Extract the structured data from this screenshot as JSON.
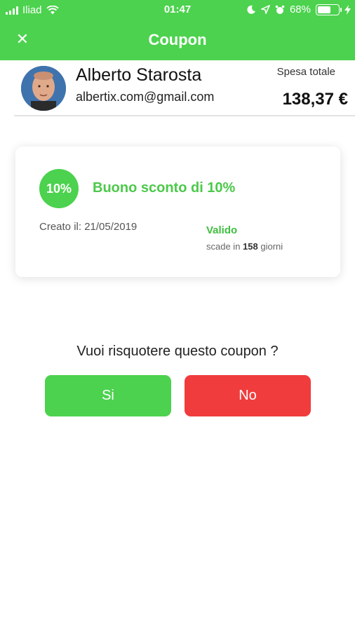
{
  "status_bar": {
    "carrier": "Iliad",
    "time": "01:47",
    "battery_text": "68%",
    "battery_level": 0.68
  },
  "header": {
    "title": "Coupon",
    "close_icon": "close-icon"
  },
  "user": {
    "name": "Alberto Starosta",
    "email": "albertix.com@gmail.com",
    "spesa_label": "Spesa totale",
    "spesa_value": "138,37 €"
  },
  "coupon": {
    "badge": "10%",
    "title": "Buono sconto di 10%",
    "created": "Creato il: 21/05/2019",
    "status": "Valido",
    "expiry_prefix": "scade in",
    "expiry_days": "158",
    "expiry_suffix": "giorni"
  },
  "prompt": {
    "question": "Vuoi risquotere questo coupon ?",
    "yes_label": "Si",
    "no_label": "No"
  },
  "colors": {
    "brand_green": "#4cd24e",
    "danger_red": "#f03c3c"
  }
}
